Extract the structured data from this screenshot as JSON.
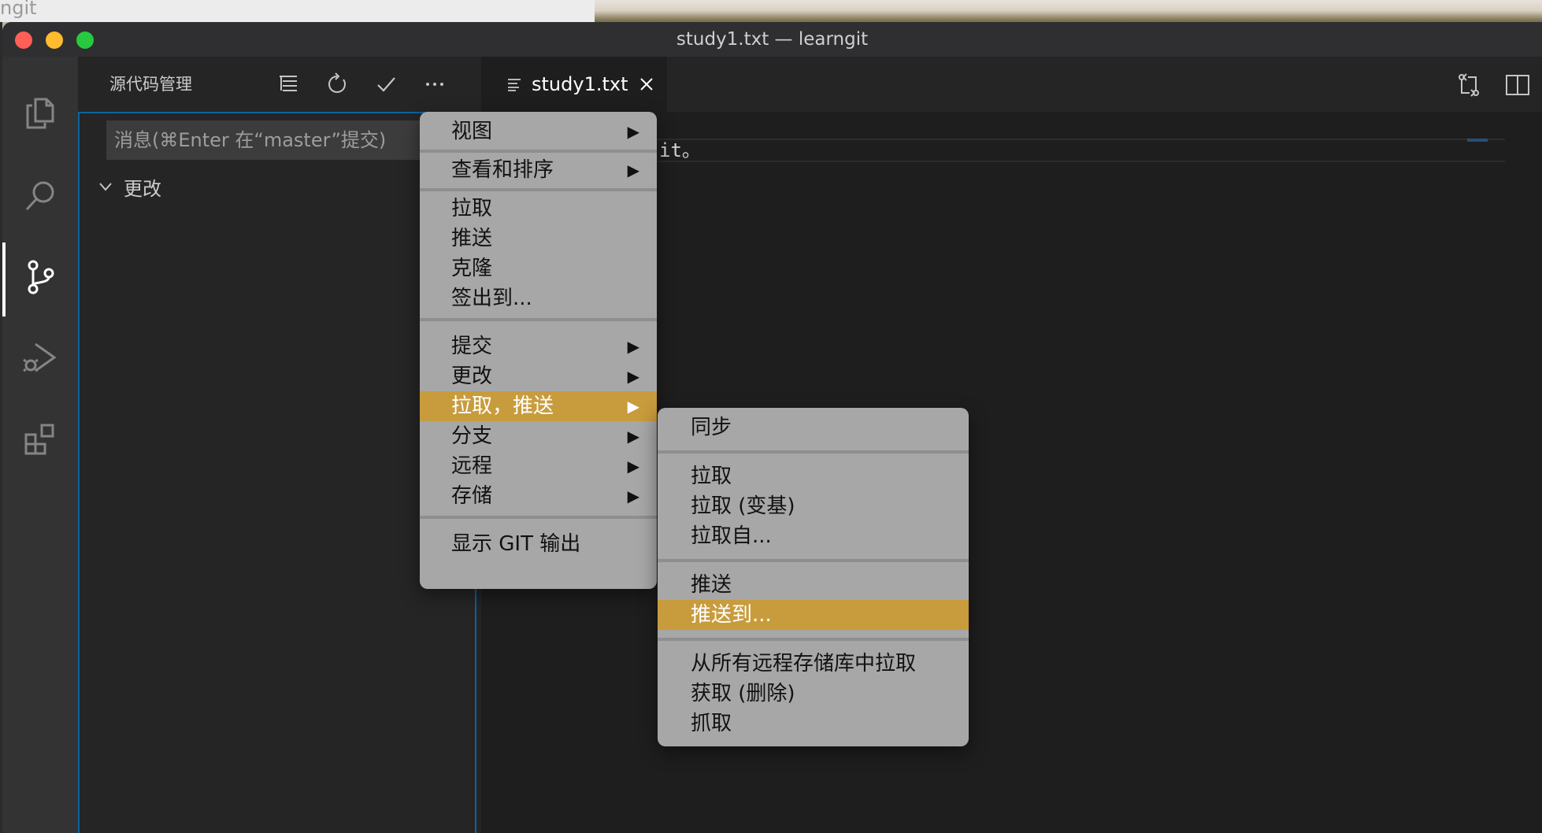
{
  "background": {
    "other_window_title": "ngit"
  },
  "window": {
    "title": "study1.txt — learngit"
  },
  "activity_bar": {
    "items": [
      "files-icon",
      "search-icon",
      "source-control-icon",
      "run-debug-icon",
      "extensions-icon"
    ],
    "active": "source-control-icon"
  },
  "sidebar": {
    "title": "源代码管理",
    "actions": [
      "tree-view-icon",
      "refresh-icon",
      "commit-check-icon",
      "more-actions-icon"
    ],
    "commit_placeholder": "消息(⌘Enter 在“master”提交)",
    "changes_label": "更改"
  },
  "editor": {
    "tab_label": "study1.txt",
    "visible_text": "it。",
    "actions": [
      "open-changes-icon",
      "split-editor-icon"
    ]
  },
  "context_menu": {
    "items": [
      {
        "label": "视图",
        "submenu": true
      },
      {
        "label": "查看和排序",
        "submenu": true
      },
      {
        "label": "拉取"
      },
      {
        "label": "推送"
      },
      {
        "label": "克隆"
      },
      {
        "label": "签出到..."
      },
      {
        "label": "提交",
        "submenu": true
      },
      {
        "label": "更改",
        "submenu": true
      },
      {
        "label": "拉取，推送",
        "submenu": true,
        "highlighted": true
      },
      {
        "label": "分支",
        "submenu": true
      },
      {
        "label": "远程",
        "submenu": true
      },
      {
        "label": "存储",
        "submenu": true
      },
      {
        "label": "显示 GIT 输出"
      }
    ],
    "arrow_glyph": "▶"
  },
  "submenu": {
    "items": [
      {
        "label": "同步"
      },
      {
        "label": "拉取"
      },
      {
        "label": "拉取 (变基)"
      },
      {
        "label": "拉取自..."
      },
      {
        "label": "推送"
      },
      {
        "label": "推送到...",
        "highlighted": true
      },
      {
        "label": "从所有远程存储库中拉取"
      },
      {
        "label": "获取 (删除)"
      },
      {
        "label": "抓取"
      }
    ]
  },
  "colors": {
    "highlight": "#c89b3c",
    "menu_bg": "#a7a7a7",
    "editor_bg": "#1e1e1e",
    "sidebar_bg": "#252526",
    "activity_bg": "#333333",
    "focus_border": "#0e639c"
  }
}
